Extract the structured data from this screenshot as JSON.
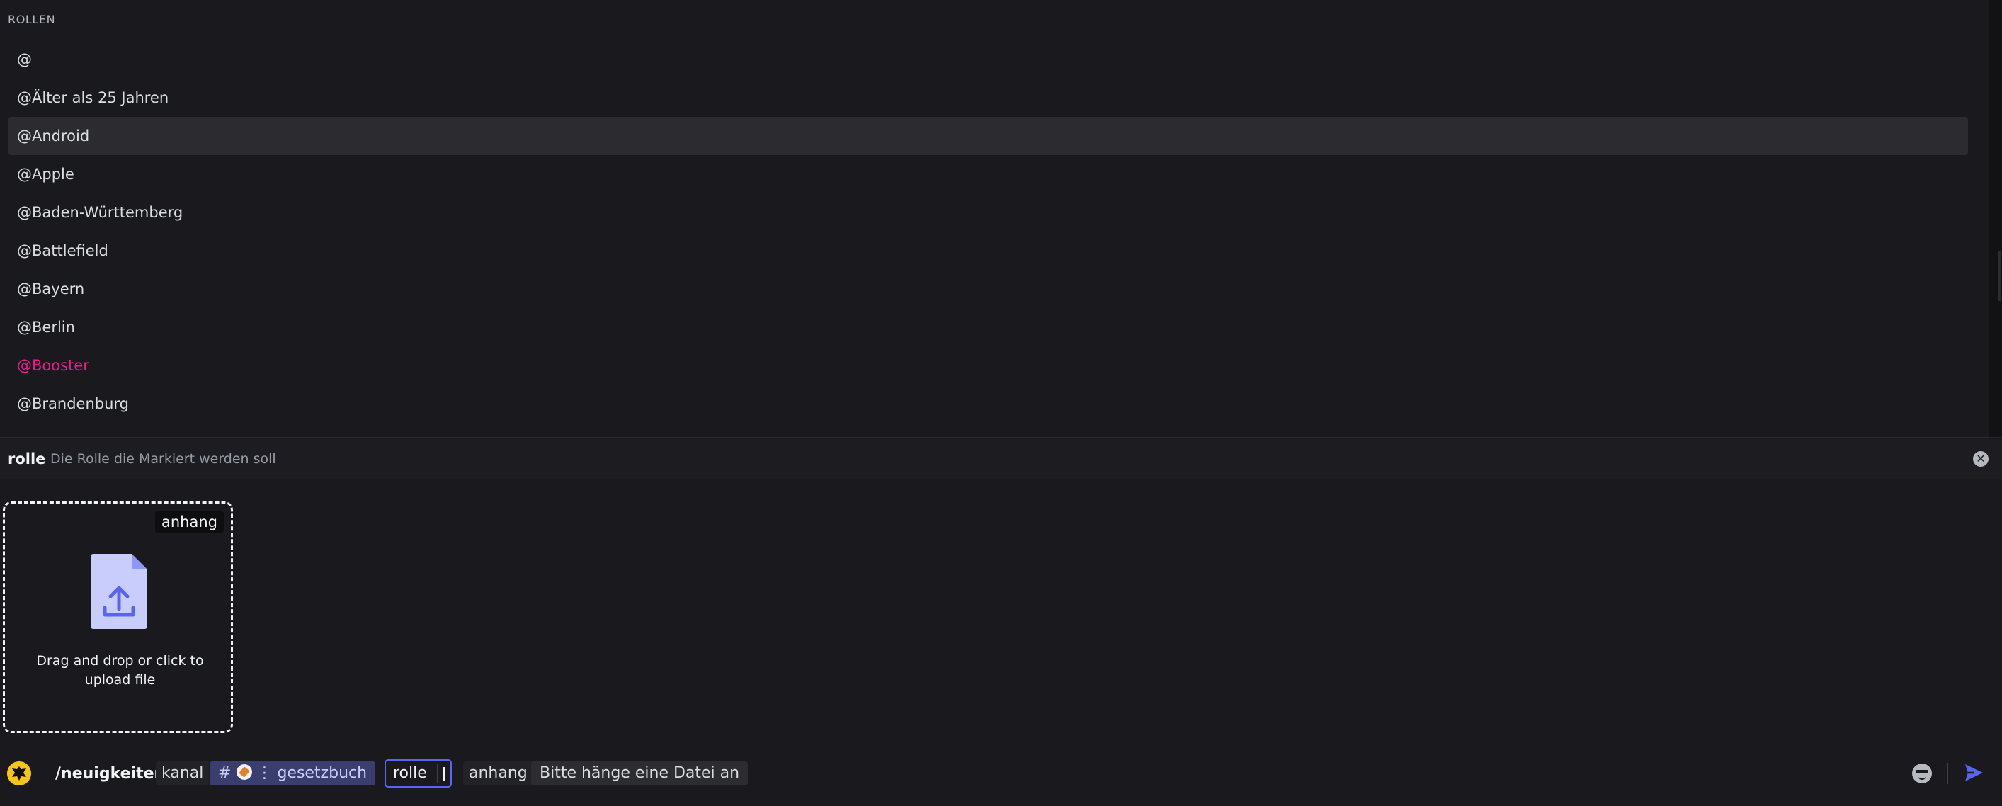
{
  "autocomplete": {
    "section_header": "ROLLEN",
    "roles": [
      {
        "label": "@"
      },
      {
        "label": "@Älter als 25 Jahren"
      },
      {
        "label": "@Android"
      },
      {
        "label": "@Apple"
      },
      {
        "label": "@Baden-Württemberg"
      },
      {
        "label": "@Battlefield"
      },
      {
        "label": "@Bayern"
      },
      {
        "label": "@Berlin"
      },
      {
        "label": "@Booster",
        "color": "#e91e8c"
      },
      {
        "label": "@Brandenburg"
      }
    ],
    "selected_index": 2
  },
  "option_info": {
    "name": "rolle",
    "description": "Die Rolle die Markiert werden soll",
    "close_icon": "close-circle-icon"
  },
  "dropzone": {
    "tag": "anhang",
    "text": "Drag and drop or click to upload file",
    "icon": "upload-file-icon",
    "icon_color": "#c9cdfb",
    "arrow_color": "#5865f2"
  },
  "composer": {
    "command": "/neuigkeiten",
    "kanal_label": "kanal",
    "kanal_hash": "#",
    "kanal_emoji_sep": "⋮",
    "kanal_value": "gesetzbuch",
    "rolle_label": "rolle",
    "anhang_label": "anhang",
    "anhang_placeholder": "Bitte hänge eine Datei an",
    "accent_color": "#5865f2"
  }
}
